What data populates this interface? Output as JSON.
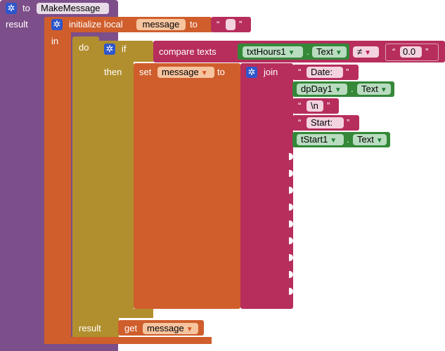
{
  "procedure": {
    "to_label": "to",
    "name": "MakeMessage",
    "result_label": "result"
  },
  "local": {
    "initialize_label": "initialize local",
    "var_name": "message",
    "to_label": "to",
    "in_label": "in"
  },
  "do_block": {
    "do_label": "do",
    "result_label": "result"
  },
  "if_block": {
    "if_label": "if",
    "then_label": "then"
  },
  "compare": {
    "label": "compare texts",
    "component": "txtHours1",
    "property": "Text",
    "operator": "≠",
    "value": "0.0"
  },
  "set": {
    "set_label": "set",
    "var_name": "message",
    "to_label": "to"
  },
  "join": {
    "label": "join",
    "items": [
      {
        "kind": "text",
        "value": "Date:"
      },
      {
        "kind": "getter",
        "component": "dpDay1",
        "property": "Text"
      },
      {
        "kind": "text",
        "value": "\\n"
      },
      {
        "kind": "text",
        "value": "Start:"
      },
      {
        "kind": "getter",
        "component": "tStart1",
        "property": "Text"
      }
    ]
  },
  "get": {
    "label": "get",
    "var_name": "message"
  },
  "punct": {
    "open_quote": "“",
    "close_quote": "”",
    "dot": "."
  },
  "icons": {
    "mutator": "gear-icon",
    "dropdown": "triangle-down-icon"
  },
  "colors": {
    "procedure": "#7d4f8a",
    "local_var": "#cf5e2c",
    "control": "#b28f2e",
    "text": "#b72e5c",
    "component": "#348838",
    "gear": "#2e56cc"
  }
}
